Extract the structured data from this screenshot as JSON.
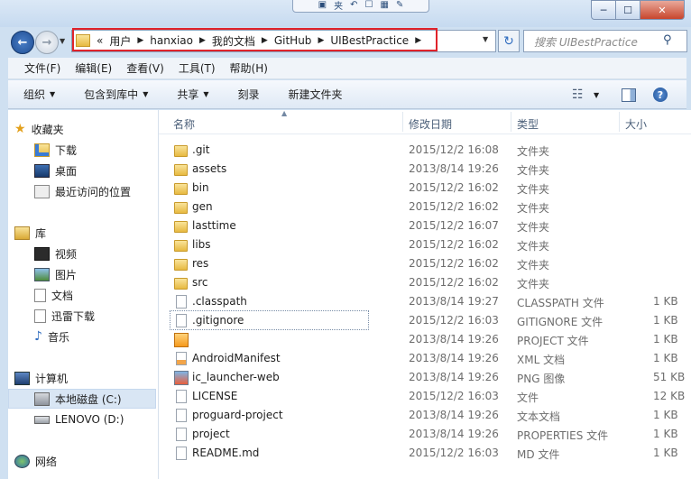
{
  "window": {
    "qat_icons": [
      "properties-icon",
      "new-folder-icon",
      "undo-icon",
      "checkbox-icon",
      "view-icon",
      "tools-icon"
    ],
    "qat_text": "夹",
    "controls": {
      "minimize": "─",
      "maximize": "☐",
      "close": "✕"
    }
  },
  "navigation": {
    "back": "←",
    "forward": "→",
    "breadcrumb": [
      "«",
      "用户",
      "hanxiao",
      "我的文档",
      "GitHub",
      "UIBestPractice"
    ],
    "separator": "▶",
    "search_placeholder": "搜索 UIBestPractice"
  },
  "menu": [
    "文件(F)",
    "编辑(E)",
    "查看(V)",
    "工具(T)",
    "帮助(H)"
  ],
  "toolbar": {
    "organize": "组织",
    "include_library": "包含到库中",
    "share": "共享",
    "burn": "刻录",
    "new_folder": "新建文件夹",
    "help": "?"
  },
  "nav_pane": {
    "favorites": "收藏夹",
    "favorites_items": [
      "下载",
      "桌面",
      "最近访问的位置"
    ],
    "libraries": "库",
    "library_items": [
      "视频",
      "图片",
      "文档",
      "迅雷下载",
      "音乐"
    ],
    "computer": "计算机",
    "computer_items": [
      "本地磁盘 (C:)",
      "LENOVO (D:)"
    ],
    "network": "网络"
  },
  "columns": {
    "name": "名称",
    "modified": "修改日期",
    "type": "类型",
    "size": "大小"
  },
  "files": [
    {
      "name": ".git",
      "modified": "2015/12/2 16:08",
      "type": "文件夹",
      "size": "",
      "icon": "folder"
    },
    {
      "name": "assets",
      "modified": "2013/8/14 19:26",
      "type": "文件夹",
      "size": "",
      "icon": "folder"
    },
    {
      "name": "bin",
      "modified": "2015/12/2 16:02",
      "type": "文件夹",
      "size": "",
      "icon": "folder"
    },
    {
      "name": "gen",
      "modified": "2015/12/2 16:02",
      "type": "文件夹",
      "size": "",
      "icon": "folder"
    },
    {
      "name": "lasttime",
      "modified": "2015/12/2 16:07",
      "type": "文件夹",
      "size": "",
      "icon": "folder"
    },
    {
      "name": "libs",
      "modified": "2015/12/2 16:02",
      "type": "文件夹",
      "size": "",
      "icon": "folder"
    },
    {
      "name": "res",
      "modified": "2015/12/2 16:02",
      "type": "文件夹",
      "size": "",
      "icon": "folder"
    },
    {
      "name": "src",
      "modified": "2015/12/2 16:02",
      "type": "文件夹",
      "size": "",
      "icon": "folder"
    },
    {
      "name": ".classpath",
      "modified": "2013/8/14 19:27",
      "type": "CLASSPATH 文件",
      "size": "1 KB",
      "icon": "doc"
    },
    {
      "name": ".gitignore",
      "modified": "2015/12/2 16:03",
      "type": "GITIGNORE 文件",
      "size": "1 KB",
      "icon": "doc"
    },
    {
      "name": "",
      "modified": "2013/8/14 19:26",
      "type": "PROJECT 文件",
      "size": "1 KB",
      "icon": "proj"
    },
    {
      "name": "AndroidManifest",
      "modified": "2013/8/14 19:26",
      "type": "XML 文档",
      "size": "1 KB",
      "icon": "xml"
    },
    {
      "name": "ic_launcher-web",
      "modified": "2013/8/14 19:26",
      "type": "PNG 图像",
      "size": "51 KB",
      "icon": "png"
    },
    {
      "name": "LICENSE",
      "modified": "2015/12/2 16:03",
      "type": "文件",
      "size": "12 KB",
      "icon": "doc"
    },
    {
      "name": "proguard-project",
      "modified": "2013/8/14 19:26",
      "type": "文本文档",
      "size": "1 KB",
      "icon": "doc"
    },
    {
      "name": "project",
      "modified": "2013/8/14 19:26",
      "type": "PROPERTIES 文件",
      "size": "1 KB",
      "icon": "doc"
    },
    {
      "name": "README.md",
      "modified": "2015/12/2 16:03",
      "type": "MD 文件",
      "size": "1 KB",
      "icon": "doc"
    }
  ]
}
